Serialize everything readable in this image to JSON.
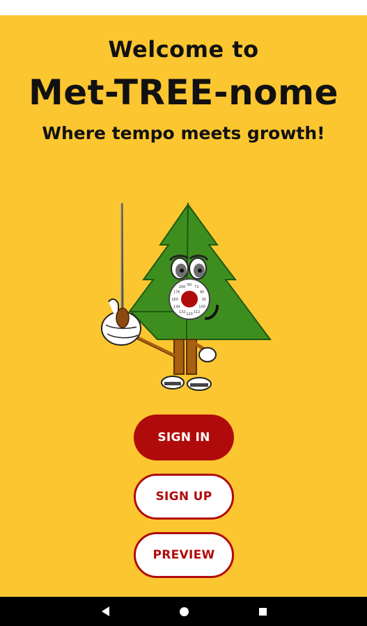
{
  "welcome": {
    "line1": "Welcome to",
    "title": "Met-TREE-nome",
    "tagline": "Where tempo meets growth!"
  },
  "mascot": {
    "name": "tree-conductor-mascot-icon",
    "dial_numbers": [
      "60",
      "72",
      "80",
      "92",
      "100",
      "112",
      "120",
      "132",
      "144",
      "160",
      "176",
      "200"
    ]
  },
  "buttons": {
    "sign_in": "SIGN IN",
    "sign_up": "SIGN UP",
    "preview": "PREVIEW"
  },
  "nav": {
    "back_icon": "back-triangle-icon",
    "home_icon": "home-circle-icon",
    "recents_icon": "recents-square-icon"
  },
  "colors": {
    "background": "#FCC630",
    "primary": "#B00B0B",
    "tree_green": "#3E8E1F",
    "text": "#111111"
  }
}
